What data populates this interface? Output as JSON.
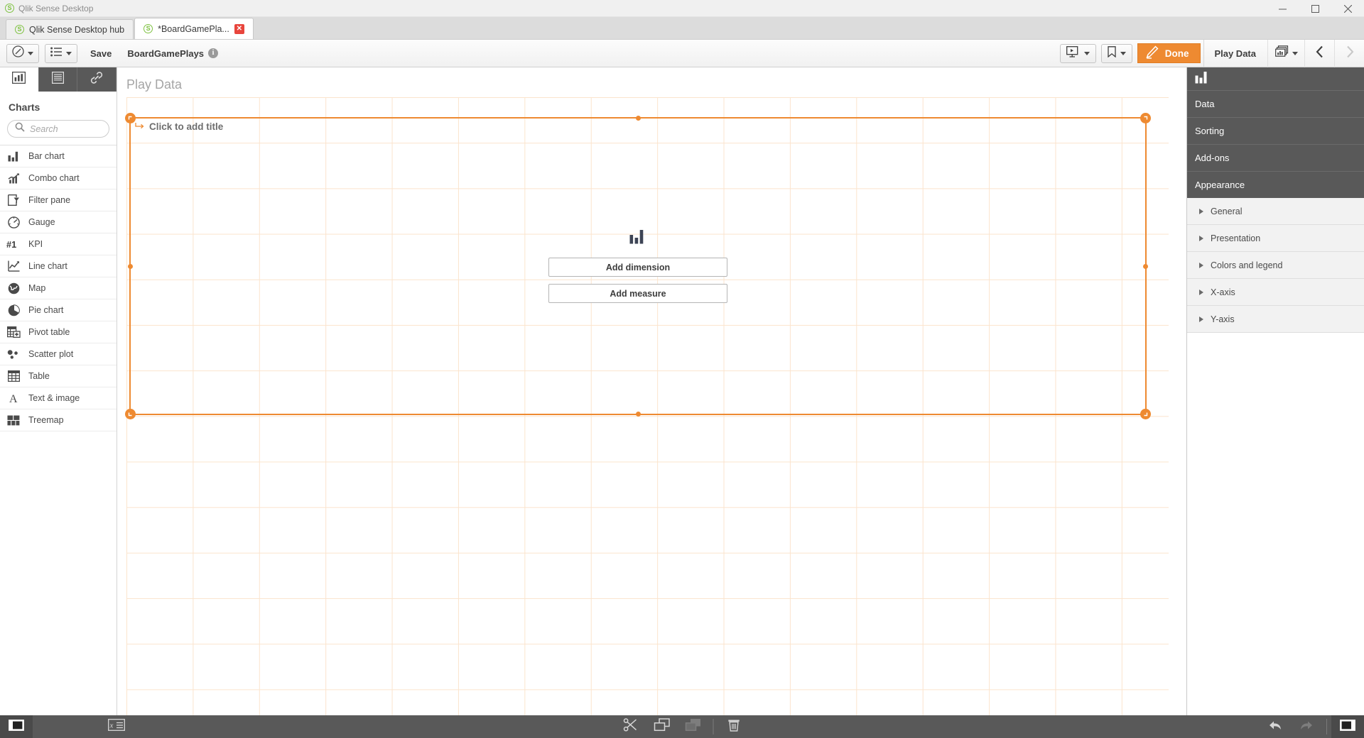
{
  "window": {
    "title": "Qlik Sense Desktop",
    "logo_icon": "qlik-logo-icon",
    "minimize_icon": "minimize-icon",
    "maximize_icon": "maximize-icon",
    "close_icon": "close-icon"
  },
  "tabs": [
    {
      "label": "Qlik Sense Desktop hub",
      "active": false,
      "closable": false,
      "icon": "qlik-logo-icon"
    },
    {
      "label": "*BoardGamePla...",
      "active": true,
      "closable": true,
      "icon": "qlik-logo-icon",
      "close_label": "✕"
    }
  ],
  "toolbar": {
    "nav_icon": "compass-icon",
    "sheets_icon": "sheet-list-icon",
    "save_label": "Save",
    "app_name": "BoardGamePlays",
    "info_icon": "info-icon",
    "info_label": "i",
    "storytelling_icon": "play-monitor-icon",
    "bookmark_icon": "bookmark-icon",
    "edit_icon": "pencil-icon",
    "done_label": "Done",
    "sheet_name": "Play Data",
    "sheet_picker_icon": "sheet-stack-icon",
    "prev_icon": "chevron-left-icon",
    "next_icon": "chevron-right-icon",
    "next_disabled": true
  },
  "sidebar": {
    "tabs": [
      {
        "name": "charts-tab",
        "icon": "bar-chart-icon",
        "active": true
      },
      {
        "name": "fields-tab",
        "icon": "table-rows-icon",
        "active": false
      },
      {
        "name": "master-items-tab",
        "icon": "link-icon",
        "active": false
      }
    ],
    "title": "Charts",
    "search": {
      "placeholder": "Search",
      "value": "",
      "icon": "search-icon"
    },
    "items": [
      {
        "label": "Bar chart",
        "icon": "bar-chart-icon"
      },
      {
        "label": "Combo chart",
        "icon": "combo-chart-icon"
      },
      {
        "label": "Filter pane",
        "icon": "filter-pane-icon"
      },
      {
        "label": "Gauge",
        "icon": "gauge-icon"
      },
      {
        "label": "KPI",
        "icon": "kpi-icon"
      },
      {
        "label": "Line chart",
        "icon": "line-chart-icon"
      },
      {
        "label": "Map",
        "icon": "map-icon"
      },
      {
        "label": "Pie chart",
        "icon": "pie-chart-icon"
      },
      {
        "label": "Pivot table",
        "icon": "pivot-table-icon"
      },
      {
        "label": "Scatter plot",
        "icon": "scatter-plot-icon"
      },
      {
        "label": "Table",
        "icon": "table-icon"
      },
      {
        "label": "Text & image",
        "icon": "text-image-icon"
      },
      {
        "label": "Treemap",
        "icon": "treemap-icon"
      }
    ]
  },
  "canvas": {
    "sheet_title": "Play Data",
    "object_title_placeholder": "Click to add title",
    "object_title_icon": "title-link-icon",
    "chart_placeholder_icon": "bar-chart-icon",
    "add_dimension_label": "Add dimension",
    "add_measure_label": "Add measure",
    "handle_icons": {
      "top_left": "resize-handle-icon",
      "top_right": "resize-handle-icon",
      "bottom_left": "resize-handle-icon",
      "bottom_right": "resize-handle-icon"
    }
  },
  "properties": {
    "header_icon": "bar-chart-icon",
    "sections": [
      {
        "label": "Data",
        "expanded": false
      },
      {
        "label": "Sorting",
        "expanded": false
      },
      {
        "label": "Add-ons",
        "expanded": false
      },
      {
        "label": "Appearance",
        "expanded": true
      }
    ],
    "appearance_subsections": [
      {
        "label": "General",
        "expanded": false
      },
      {
        "label": "Presentation",
        "expanded": false
      },
      {
        "label": "Colors and legend",
        "expanded": false
      },
      {
        "label": "X-axis",
        "expanded": false
      },
      {
        "label": "Y-axis",
        "expanded": false
      }
    ]
  },
  "bottombar": {
    "left_panel_toggle_icon": "left-panel-toggle-icon",
    "expression_icon": "expression-editor-icon",
    "cut_icon": "scissors-icon",
    "copy_icon": "copy-icon",
    "paste_icon": "paste-icon",
    "paste_disabled": true,
    "delete_icon": "trash-icon",
    "undo_icon": "undo-arrow-icon",
    "redo_icon": "redo-arrow-icon",
    "redo_disabled": true,
    "right_panel_toggle_icon": "right-panel-toggle-icon"
  },
  "colors": {
    "accent": "#ee8a31",
    "panel_dark": "#595959",
    "grid_line": "#fbe4cd",
    "qlik_green": "#7fc242"
  }
}
